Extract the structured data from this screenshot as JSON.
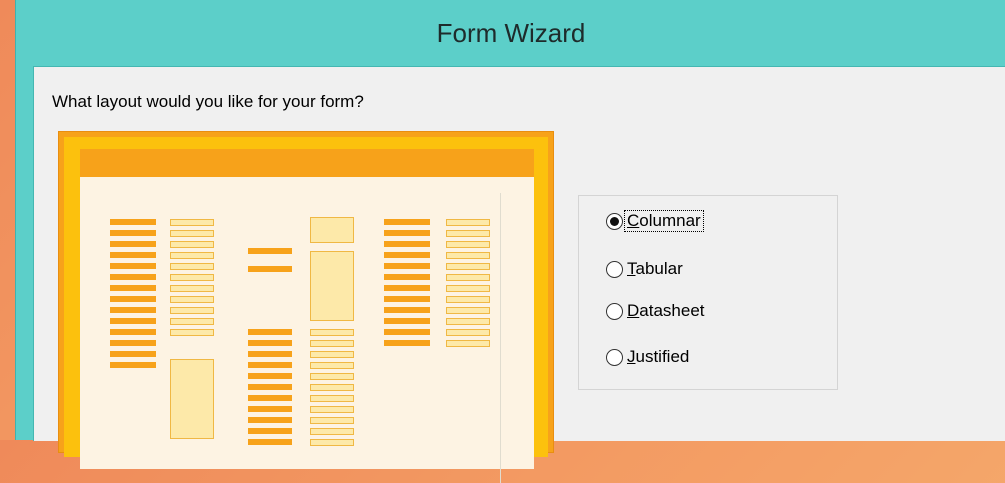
{
  "window": {
    "title": "Form Wizard"
  },
  "wizard": {
    "question": "What layout would you like for your form?",
    "options": [
      {
        "access": "C",
        "rest": "olumnar",
        "selected": true
      },
      {
        "access": "T",
        "rest": "abular",
        "selected": false
      },
      {
        "access": "D",
        "rest": "atasheet",
        "selected": false
      },
      {
        "access": "J",
        "rest": "ustified",
        "selected": false
      }
    ]
  },
  "colors": {
    "title_bar": "#5ccfc9",
    "preview_accent": "#f7a21a",
    "preview_frame": "#fcc10d",
    "preview_page": "#fdf3e3"
  }
}
